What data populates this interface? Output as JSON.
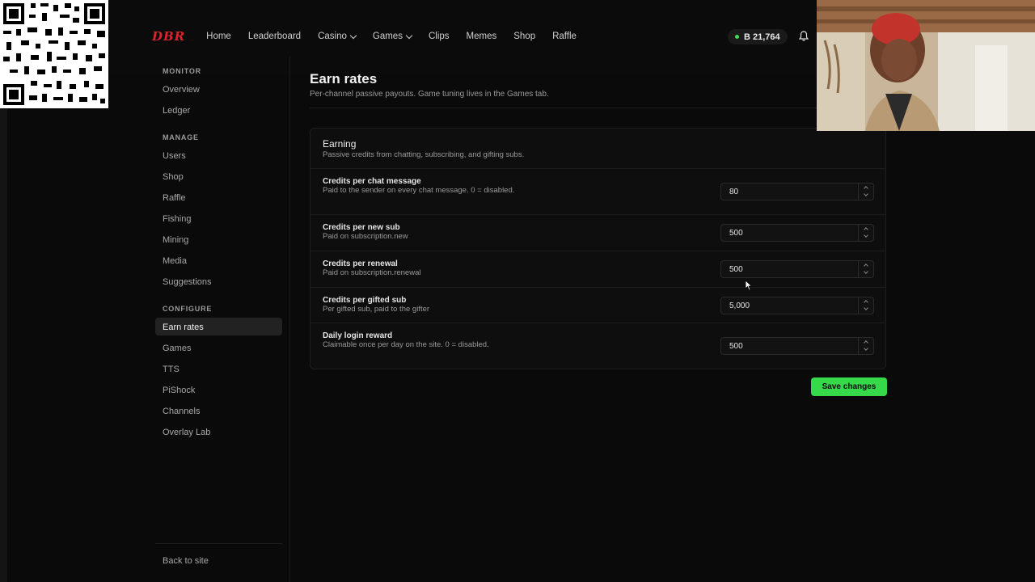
{
  "brand": {
    "logo": "DBR",
    "accent": "#d8262b",
    "save_color": "#35d94a"
  },
  "nav": {
    "links": [
      "Home",
      "Leaderboard",
      "Casino",
      "Games",
      "Clips",
      "Memes",
      "Shop",
      "Raffle"
    ],
    "balance": "B 21,764"
  },
  "sidebar": {
    "sections": [
      {
        "label": "MONITOR",
        "items": [
          "Overview",
          "Ledger"
        ]
      },
      {
        "label": "MANAGE",
        "items": [
          "Users",
          "Shop",
          "Raffle",
          "Fishing",
          "Mining",
          "Media",
          "Suggestions"
        ]
      },
      {
        "label": "CONFIGURE",
        "items": [
          "Earn rates",
          "Games",
          "TTS",
          "PiShock",
          "Channels",
          "Overlay Lab"
        ]
      }
    ],
    "active": "Earn rates",
    "back": "Back to site"
  },
  "page": {
    "title": "Earn rates",
    "subtitle": "Per-channel passive payouts. Game tuning lives in the Games tab."
  },
  "card": {
    "title": "Earning",
    "subtitle": "Passive credits from chatting, subscribing, and gifting subs.",
    "rows": [
      {
        "label": "Credits per chat message",
        "desc": "Paid to the sender on every chat message. 0 = disabled.",
        "value": "80"
      },
      {
        "label": "Credits per new sub",
        "desc": "Paid on subscription.new",
        "value": "500"
      },
      {
        "label": "Credits per renewal",
        "desc": "Paid on subscription.renewal",
        "value": "500"
      },
      {
        "label": "Credits per gifted sub",
        "desc": "Per gifted sub, paid to the gifter",
        "value": "5,000"
      },
      {
        "label": "Daily login reward",
        "desc": "Claimable once per day on the site. 0 = disabled.",
        "value": "500"
      }
    ]
  },
  "actions": {
    "save": "Save changes"
  }
}
